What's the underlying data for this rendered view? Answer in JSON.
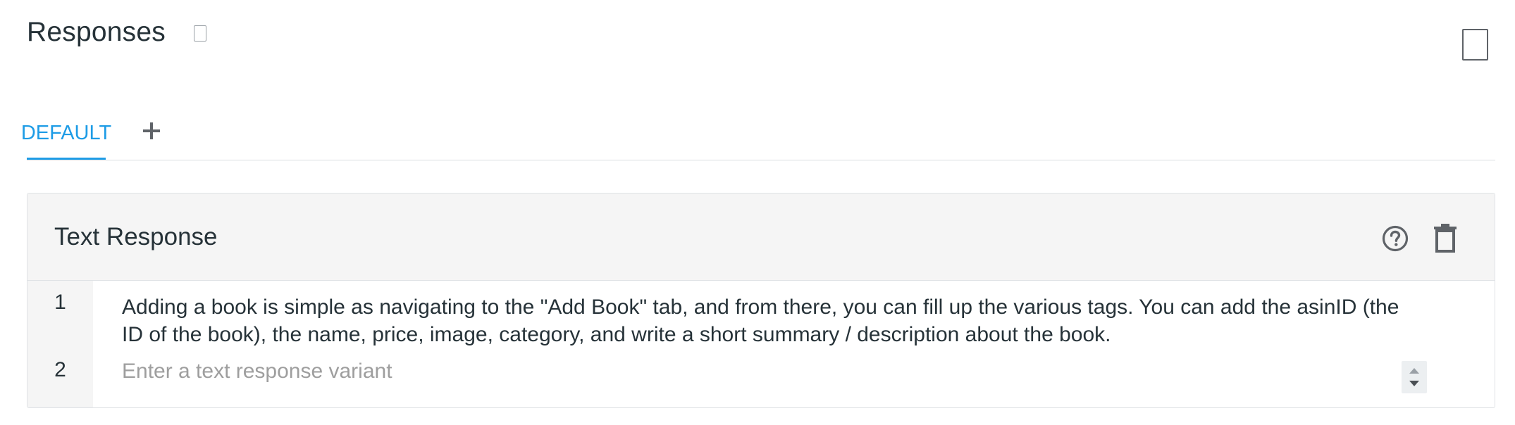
{
  "header": {
    "title": "Responses"
  },
  "tabs": {
    "items": [
      {
        "label": "DEFAULT",
        "active": true
      }
    ],
    "add_icon": "plus-icon"
  },
  "card": {
    "title": "Text Response",
    "icons": [
      "help-circle-icon",
      "trash-icon"
    ],
    "rows": [
      {
        "number": "1",
        "text": "Adding a book is simple as navigating to the \"Add Book\" tab, and from there, you can fill up the various tags. You can add the asinID (the ID of the book), the name, price, image, category, and write a short summary / description about the book."
      },
      {
        "number": "2",
        "value": "",
        "placeholder": "Enter a text response variant"
      }
    ]
  },
  "colors": {
    "accent": "#1e9ce6",
    "text": "#263238",
    "muted": "#9e9e9e",
    "header_bg": "#f5f5f5",
    "icon": "#5f6368"
  }
}
